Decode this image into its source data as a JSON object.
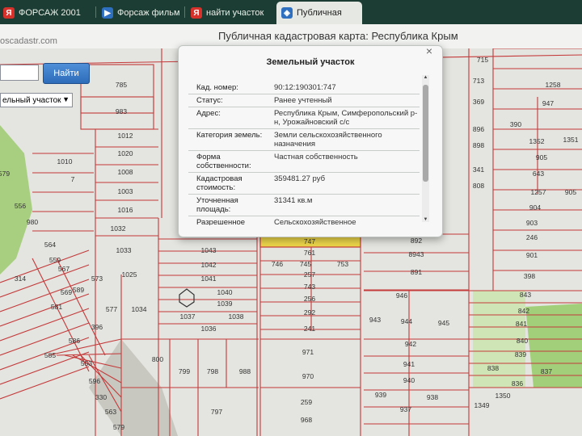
{
  "browser": {
    "tabs": [
      {
        "label": "ФОРСАЖ 2001",
        "icon": "yandex-icon",
        "glyph": "Я"
      },
      {
        "label": "Форсаж фильм",
        "icon": "video-icon",
        "glyph": "▶"
      },
      {
        "label": "найти участок",
        "icon": "yandex-icon",
        "glyph": "Я"
      },
      {
        "label": "Публичная",
        "icon": "map-icon",
        "glyph": "◈"
      }
    ],
    "url": "pkk5.rosreestr.ru/#"
  },
  "page": {
    "title": "Публичная кадастровая карта: Республика Крым",
    "url_fragment": "oscadastr.com"
  },
  "search": {
    "input_value": "",
    "button_label": "Найти",
    "select_value": "ельный участок"
  },
  "map": {
    "plot_labels": [
      "785",
      "983",
      "1012",
      "1020",
      "1010",
      "1008",
      "7",
      "1003",
      "1016",
      "1032",
      "1033",
      "1025",
      "1034",
      "1043",
      "1042",
      "1041",
      "1040",
      "1039",
      "1037",
      "1038",
      "1036",
      "746",
      "745",
      "753",
      "761",
      "747",
      "257",
      "743",
      "256",
      "292",
      "241",
      "892",
      "8943",
      "891",
      "946",
      "943",
      "944",
      "945",
      "942",
      "971",
      "941",
      "940",
      "970",
      "939",
      "938",
      "259",
      "937",
      "968",
      "800",
      "799",
      "798",
      "988",
      "797",
      "589",
      "581",
      "586",
      "585",
      "553",
      "596",
      "330",
      "563",
      "579",
      "573",
      "577",
      "396",
      "314",
      "579",
      "556",
      "564",
      "559",
      "567",
      "569",
      "980",
      "949",
      "1258",
      "947",
      "390",
      "1352",
      "1351",
      "905",
      "643",
      "1257",
      "905",
      "904",
      "903",
      "246",
      "901",
      "398",
      "843",
      "842",
      "841",
      "840",
      "839",
      "838",
      "837",
      "836",
      "1350",
      "1349",
      "718",
      "715",
      "713",
      "369",
      "896",
      "341",
      "898",
      "808"
    ]
  },
  "popup": {
    "title": "Земельный участок",
    "rows": [
      {
        "label": "Кад. номер:",
        "value": "90:12:190301:747"
      },
      {
        "label": "Статус:",
        "value": "Ранее учтенный"
      },
      {
        "label": "Адрес:",
        "value": "Республика Крым, Симферопольский р-н, Урожайновский с/с"
      },
      {
        "label": "Категория земель:",
        "value": "Земли сельскохозяйственного назначения"
      },
      {
        "label": "Форма собственности:",
        "value": "Частная собственность"
      },
      {
        "label": "Кадастровая стоимость:",
        "value": "359481.27 руб"
      },
      {
        "label": "Уточненная площадь:",
        "value": "31341 кв.м"
      },
      {
        "label": "Разрешенное",
        "value": "Сельскохозяйственное"
      }
    ],
    "close_glyph": "×"
  },
  "colors": {
    "parcel_border": "#c43a3a",
    "highlight": "#ecd64a",
    "green": "#9fcd77",
    "tab_bar": "#1c3d33"
  }
}
